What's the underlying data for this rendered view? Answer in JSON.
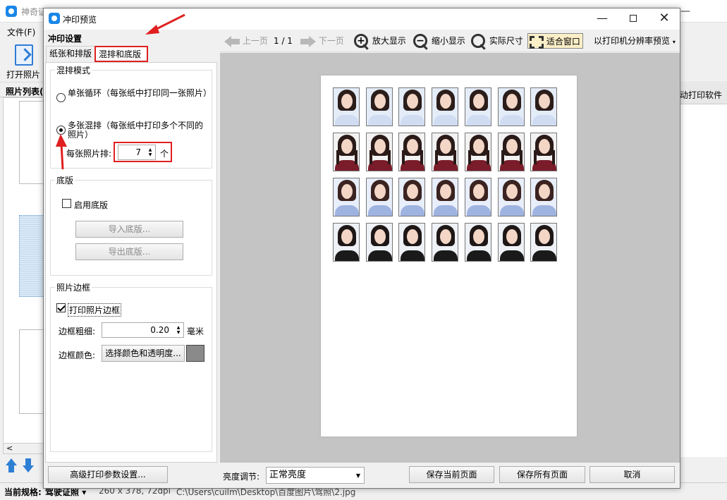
{
  "background_window": {
    "title": "神奇证",
    "menu_file": "文件(F)",
    "open_photo": "打开照片",
    "photo_list": "照片列表(",
    "right_header": "动打印软件",
    "status": {
      "label": "当前规格:",
      "spec": "驾驶证照",
      "dimensions": "260 x 378, 72dpi",
      "path": "C:\\Users\\cuilm\\Desktop\\百度图片\\驾照\\2.jpg"
    }
  },
  "dialog": {
    "title": "冲印预览",
    "settings_title": "冲印设置",
    "tabs": [
      "纸张和排版",
      "混排和底版"
    ],
    "mix_group": {
      "title": "混排模式",
      "single_cycle": "单张循环（每张纸中打印同一张照片）",
      "multi_mix": "多张混排（每张纸中打印多个不同的照片）",
      "per_photo_label": "每张照片排:",
      "per_photo_value": "7",
      "per_photo_unit": "个"
    },
    "base_group": {
      "title": "底版",
      "enable": "启用底版",
      "import": "导入底版...",
      "export": "导出底版..."
    },
    "border_group": {
      "title": "照片边框",
      "print_border": "打印照片边框",
      "width_label": "边框粗细:",
      "width_value": "0.20",
      "width_unit": "毫米",
      "color_label": "边框颜色:",
      "color_button": "选择颜色和透明度...",
      "color_value": "#8a8a8a"
    },
    "toolbar": {
      "prev": "上一页",
      "page": "1 / 1",
      "next": "下一页",
      "zoom_in": "放大显示",
      "zoom_out": "缩小显示",
      "actual": "实际尺寸",
      "fit": "适合窗口",
      "printer_res": "以打印机分辨率预览"
    },
    "bottom": {
      "advanced": "高级打印参数设置...",
      "brightness_label": "亮度调节:",
      "brightness_value": "正常亮度",
      "save_current": "保存当前页面",
      "save_all": "保存所有页面",
      "cancel": "取消"
    }
  },
  "photo_rows": [
    {
      "name": "row-1-woman-short-hair",
      "hair": "#2b1d1a",
      "body": "#cfdcf2",
      "bg": "#e4ecf8",
      "braids": false
    },
    {
      "name": "row-2-girl-braids-uniform",
      "hair": "#2a1a18",
      "body": "#7a1c2a",
      "bg": "#f2f2f2",
      "braids": true
    },
    {
      "name": "row-3-woman-blue-shirt",
      "hair": "#3a2320",
      "body": "#9fb3e0",
      "bg": "#e8eefa",
      "braids": false
    },
    {
      "name": "row-4-woman-black-top",
      "hair": "#1e1716",
      "body": "#1a1a1a",
      "bg": "#eef1f6",
      "braids": false
    }
  ]
}
